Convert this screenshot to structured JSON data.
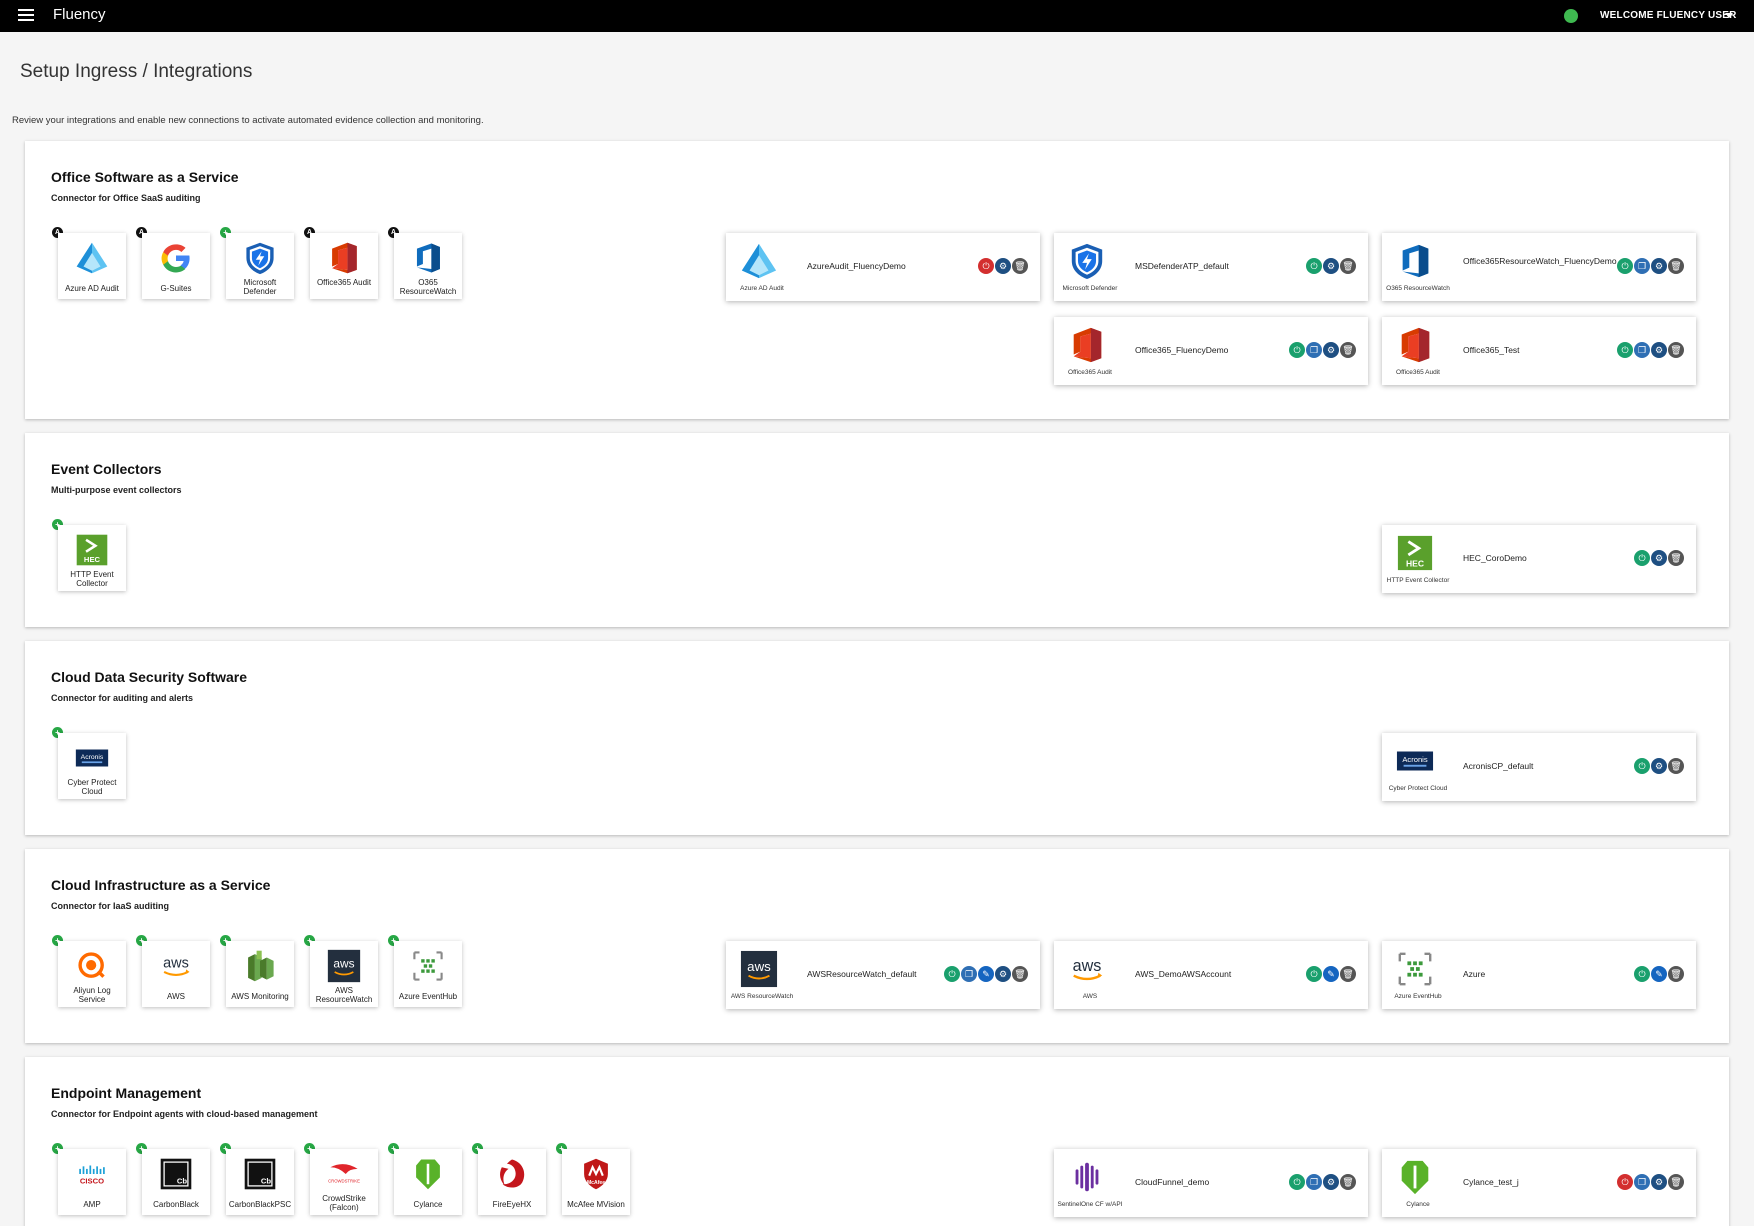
{
  "header": {
    "brand": "Fluency",
    "welcome": "WELCOME FLUENCY USER",
    "status_color": "#3fb950"
  },
  "page": {
    "title": "Setup Ingress / Integrations",
    "subtitle": "Review your integrations and enable new connections to activate automated evidence collection and monitoring."
  },
  "sections": [
    {
      "title": "Office Software as a Service",
      "subtitle": "Connector for Office SaaS auditing",
      "tiles": [
        {
          "label": "Azure AD Audit",
          "icon": "azure-ad-icon",
          "badge": "A"
        },
        {
          "label": "G-Suites",
          "icon": "google-icon",
          "badge": "A"
        },
        {
          "label": "Microsoft Defender",
          "icon": "defender-icon",
          "badge": "+"
        },
        {
          "label": "Office365 Audit",
          "icon": "office365-icon",
          "badge": "A"
        },
        {
          "label": "O365 ResourceWatch",
          "icon": "o365-resourcewatch-icon",
          "badge": "A"
        }
      ],
      "cards": [
        {
          "name": "AzureAudit_FluencyDemo",
          "label": "Azure AD Audit",
          "icon": "azure-ad-icon",
          "actions": [
            "off",
            "gear",
            "del"
          ]
        },
        {
          "name": "MSDefenderATP_default",
          "label": "Microsoft Defender",
          "icon": "defender-icon",
          "actions": [
            "on",
            "gear",
            "del"
          ]
        },
        {
          "name": "Office365ResourceWatch_FluencyDemo",
          "label": "O365 ResourceWatch",
          "icon": "o365-resourcewatch-icon",
          "actions": [
            "on",
            "clone",
            "gear",
            "del"
          ]
        },
        {
          "name": "Office365_FluencyDemo",
          "label": "Office365 Audit",
          "icon": "office365-icon",
          "actions": [
            "on",
            "clone",
            "gear",
            "del"
          ]
        },
        {
          "name": "Office365_Test",
          "label": "Office365 Audit",
          "icon": "office365-icon",
          "actions": [
            "on",
            "clone",
            "gear",
            "del"
          ]
        }
      ]
    },
    {
      "title": "Event Collectors",
      "subtitle": "Multi-purpose event collectors",
      "tiles": [
        {
          "label": "HTTP Event Collector",
          "icon": "hec-icon",
          "badge": "+"
        }
      ],
      "cards": [
        {
          "name": "HEC_CoroDemo",
          "label": "HTTP Event Collector",
          "icon": "hec-icon",
          "actions": [
            "on",
            "gear",
            "del"
          ]
        }
      ]
    },
    {
      "title": "Cloud Data Security Software",
      "subtitle": "Connector for auditing and alerts",
      "tiles": [
        {
          "label": "Cyber Protect Cloud",
          "icon": "acronis-icon",
          "badge": "+"
        }
      ],
      "cards": [
        {
          "name": "AcronisCP_default",
          "label": "Cyber Protect Cloud",
          "icon": "acronis-icon",
          "actions": [
            "on",
            "gear",
            "del"
          ]
        }
      ]
    },
    {
      "title": "Cloud Infrastructure as a Service",
      "subtitle": "Connector for IaaS auditing",
      "tiles": [
        {
          "label": "Aliyun Log Service",
          "icon": "aliyun-icon",
          "badge": "+"
        },
        {
          "label": "AWS",
          "icon": "aws-icon",
          "badge": "+"
        },
        {
          "label": "AWS Monitoring",
          "icon": "aws-monitoring-icon",
          "badge": "+"
        },
        {
          "label": "AWS ResourceWatch",
          "icon": "aws-resourcewatch-icon",
          "badge": "+"
        },
        {
          "label": "Azure EventHub",
          "icon": "azure-eventhub-icon",
          "badge": "+"
        }
      ],
      "cards": [
        {
          "name": "AWSResourceWatch_default",
          "label": "AWS ResourceWatch",
          "icon": "aws-resourcewatch-icon",
          "actions": [
            "on",
            "clone",
            "edit",
            "gear",
            "del"
          ]
        },
        {
          "name": "AWS_DemoAWSAccount",
          "label": "AWS",
          "icon": "aws-icon",
          "actions": [
            "on",
            "edit",
            "del"
          ]
        },
        {
          "name": "Azure",
          "label": "Azure EventHub",
          "icon": "azure-eventhub-icon",
          "actions": [
            "on",
            "edit",
            "del"
          ]
        }
      ]
    },
    {
      "title": "Endpoint Management",
      "subtitle": "Connector for Endpoint agents with cloud-based management",
      "tiles": [
        {
          "label": "AMP",
          "icon": "cisco-icon",
          "badge": "+"
        },
        {
          "label": "CarbonBlack",
          "icon": "carbonblack-icon",
          "badge": "+"
        },
        {
          "label": "CarbonBlackPSC",
          "icon": "carbonblack-icon",
          "badge": "+"
        },
        {
          "label": "CrowdStrike (Falcon)",
          "icon": "crowdstrike-icon",
          "badge": "+"
        },
        {
          "label": "Cylance",
          "icon": "cylance-icon",
          "badge": "+"
        },
        {
          "label": "FireEyeHX",
          "icon": "fireeye-icon",
          "badge": "+"
        },
        {
          "label": "McAfee MVision",
          "icon": "mcafee-icon",
          "badge": "+"
        }
      ],
      "cards": [
        {
          "name": "CloudFunnel_demo",
          "label": "SentinelOne CF w/API",
          "icon": "sentinelone-icon",
          "actions": [
            "on",
            "clone",
            "gear",
            "del"
          ]
        },
        {
          "name": "Cylance_test_j",
          "label": "Cylance",
          "icon": "cylance-icon",
          "actions": [
            "off",
            "clone",
            "gear",
            "del"
          ]
        }
      ]
    }
  ]
}
